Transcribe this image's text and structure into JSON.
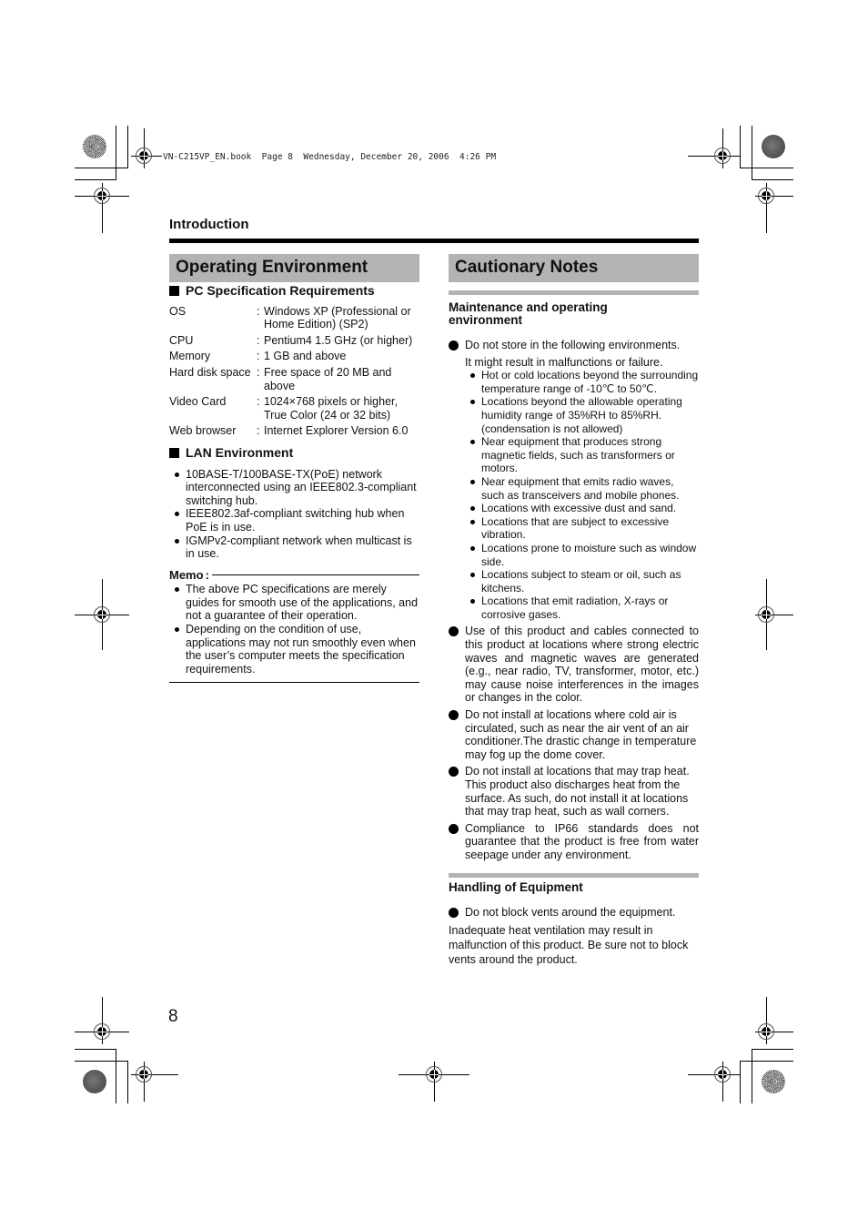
{
  "print_header": {
    "text": "VN-C215VP_EN.book  Page 8  Wednesday, December 20, 2006  4:26 PM"
  },
  "section_label": "Introduction",
  "left": {
    "title": "Operating Environment",
    "pc_spec": {
      "heading": "PC Specification Requirements",
      "rows": [
        {
          "key": "OS",
          "value": "Windows XP (Professional or Home Edition) (SP2)"
        },
        {
          "key": "CPU",
          "value": "Pentium4 1.5 GHz (or higher)"
        },
        {
          "key": "Memory",
          "value": "1 GB and above"
        },
        {
          "key": "Hard disk space",
          "value": "Free space of 20 MB and above"
        },
        {
          "key": "Video Card",
          "value": "1024×768 pixels or higher, True Color (24 or 32 bits)"
        },
        {
          "key": "Web browser",
          "value": "Internet Explorer Version 6.0"
        }
      ]
    },
    "lan": {
      "heading": "LAN Environment",
      "items": [
        "10BASE-T/100BASE-TX(PoE) network interconnected using an IEEE802.3-compliant switching hub.",
        "IEEE802.3af-compliant switching hub when PoE is in use.",
        "IGMPv2-compliant network when multicast is in use."
      ]
    },
    "memo": {
      "label": "Memo",
      "colon": ":",
      "items": [
        "The above PC specifications are merely guides for smooth use of the applications, and not a guarantee of their operation.",
        "Depending on the condition of use, applications may not run smoothly even when the user’s computer meets the specification requirements."
      ]
    }
  },
  "right": {
    "title": "Cautionary Notes",
    "maintenance": {
      "heading": "Maintenance and operating environment",
      "store": {
        "text": "Do not store in the following environments.",
        "note": "It might result in malfunctions or failure.",
        "items": [
          "Hot or cold locations beyond the surrounding temperature range of -10℃ to 50℃.",
          "Locations beyond the allowable operating humidity range of 35%RH to 85%RH. (condensation is not allowed)",
          "Near equipment that produces strong magnetic fields, such as transformers or motors.",
          "Near equipment that emits radio waves, such as transceivers and mobile phones.",
          "Locations with excessive dust and sand.",
          "Locations that are subject to excessive vibration.",
          "Locations prone to moisture such as window side.",
          "Locations subject to steam or oil, such as kitchens.",
          "Locations that emit radiation, X-rays or corrosive gases."
        ]
      },
      "items": [
        "Use of this product and cables connected to this product at locations where strong electric waves and magnetic waves are generated (e.g., near radio, TV, transformer, motor, etc.) may cause noise interferences in the images or changes in the color.",
        "Do not install at locations where cold air is circulated, such as near the air vent of an air conditioner.The drastic change in temperature may fog up the dome cover.",
        "Do not install at locations that may trap heat. This product also discharges heat from the surface. As such, do not install it at locations that may trap heat, such as wall corners.",
        "Compliance to IP66 standards does not guarantee that the product is free from water seepage under any environment."
      ]
    },
    "handling": {
      "heading": "Handling of Equipment",
      "item": "Do not block vents around the equipment.",
      "paragraph": "Inadequate heat ventilation may result in malfunction of this product. Be sure not to block vents around the product."
    }
  },
  "page_number": "8"
}
